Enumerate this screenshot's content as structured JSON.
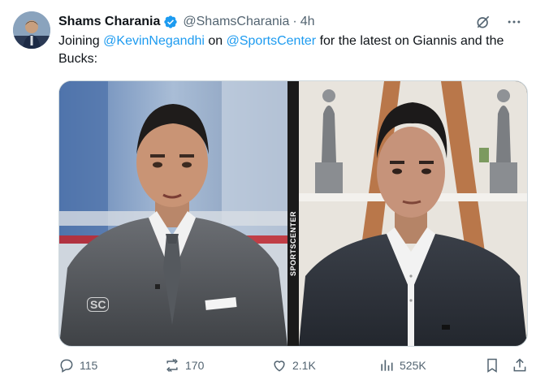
{
  "tweet": {
    "author_name": "Shams Charania",
    "handle": "@ShamsCharania",
    "separator": "·",
    "time": "4h",
    "text_prefix": "Joining ",
    "mention1": "@KevinNegandhi",
    "text_mid": " on ",
    "mention2": "@SportsCenter",
    "text_suffix": " for the latest on Giannis and the Bucks:"
  },
  "media": {
    "show_vertical_text": "SPORTSCENTER",
    "logo_text": "SC"
  },
  "actions": {
    "replies": "115",
    "retweets": "170",
    "likes": "2.1K",
    "views": "525K"
  },
  "colors": {
    "accent": "#1d9bf0",
    "text_secondary": "#536471",
    "verified": "#1d9bf0"
  },
  "icons": [
    "grok-icon",
    "more-icon",
    "reply-icon",
    "retweet-icon",
    "like-icon",
    "views-icon",
    "bookmark-icon",
    "share-icon",
    "verified-icon"
  ]
}
